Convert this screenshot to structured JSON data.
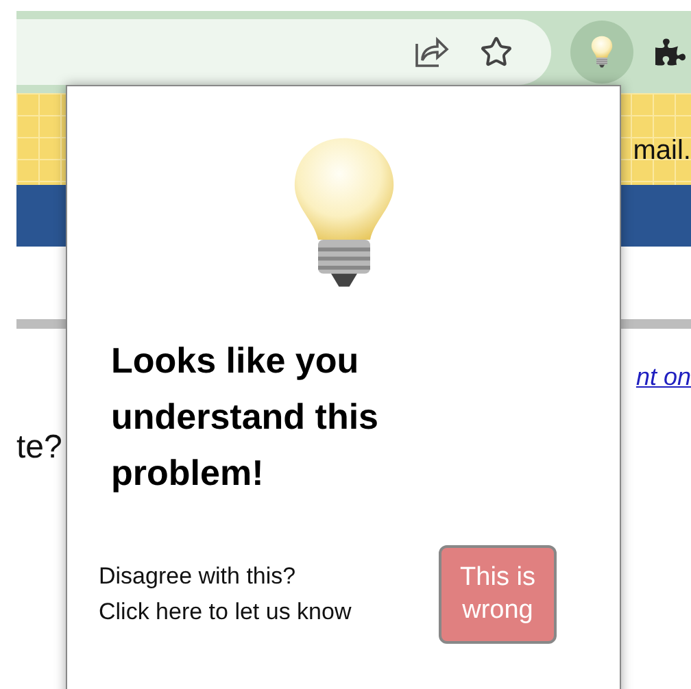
{
  "browser_toolbar": {
    "extension_active": true
  },
  "page": {
    "header_text": "mail.",
    "link_text": "nt on",
    "question_text": "te?"
  },
  "popup": {
    "heading": "Looks like you understand this problem!",
    "feedback_lines": [
      "Disagree with this?",
      "Click here to let us know"
    ],
    "button": "This is wrong"
  }
}
